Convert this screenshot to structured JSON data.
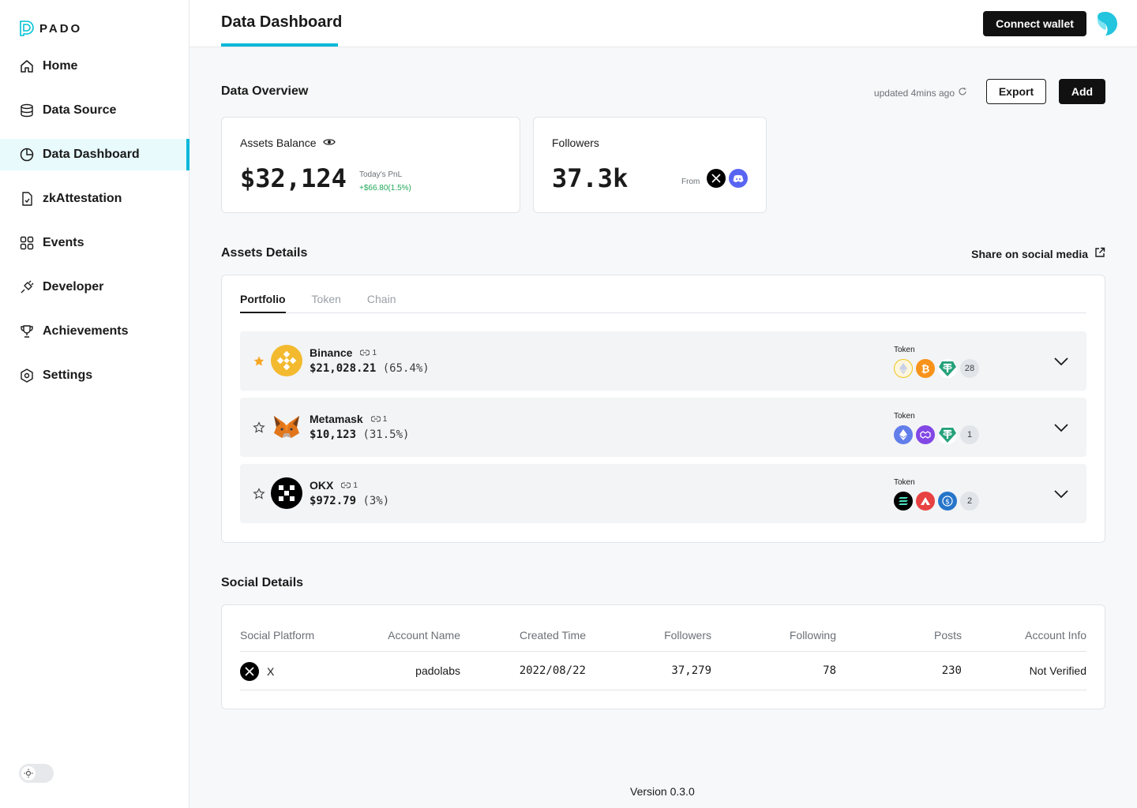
{
  "app": {
    "logo_text": "PADO"
  },
  "sidebar": {
    "items": [
      {
        "label": "Home",
        "icon": "home-icon"
      },
      {
        "label": "Data Source",
        "icon": "database-icon"
      },
      {
        "label": "Data Dashboard",
        "icon": "pie-chart-icon",
        "active": true
      },
      {
        "label": "zkAttestation",
        "icon": "document-check-icon"
      },
      {
        "label": "Events",
        "icon": "grid-icon"
      },
      {
        "label": "Developer",
        "icon": "plug-icon"
      },
      {
        "label": "Achievements",
        "icon": "trophy-icon"
      },
      {
        "label": "Settings",
        "icon": "settings-icon"
      }
    ],
    "theme_toggle": "light"
  },
  "header": {
    "title": "Data Dashboard",
    "connect_label": "Connect wallet"
  },
  "overview": {
    "title": "Data Overview",
    "updated": "updated 4mins ago",
    "export_label": "Export",
    "add_label": "Add",
    "assets": {
      "label": "Assets Balance",
      "value": "$32,124",
      "pnl_label": "Today's PnL",
      "pnl_value": "+$66.80(1.5%)"
    },
    "followers": {
      "label": "Followers",
      "value": "37.3k",
      "from_label": "From"
    }
  },
  "assets_details": {
    "title": "Assets Details",
    "share_label": "Share on social media",
    "tabs": [
      "Portfolio",
      "Token",
      "Chain"
    ],
    "token_label": "Token",
    "rows": [
      {
        "name": "Binance",
        "links": "1",
        "value": "$21,028.21",
        "pct": "(65.4%)",
        "starred": true,
        "tokens": [
          "eth",
          "btc",
          "usdt"
        ],
        "more": "28"
      },
      {
        "name": "Metamask",
        "links": "1",
        "value": "$10,123",
        "pct": "(31.5%)",
        "starred": false,
        "tokens": [
          "eth",
          "matic",
          "usdt"
        ],
        "more": "1"
      },
      {
        "name": "OKX",
        "links": "1",
        "value": "$972.79",
        "pct": "(3%)",
        "starred": false,
        "tokens": [
          "sol",
          "avax",
          "usdc"
        ],
        "more": "2"
      }
    ]
  },
  "social_details": {
    "title": "Social Details",
    "columns": [
      "Social Platform",
      "Account Name",
      "Created Time",
      "Followers",
      "Following",
      "Posts",
      "Account Info"
    ],
    "rows": [
      {
        "platform": "X",
        "account": "padolabs",
        "created": "2022/08/22",
        "followers": "37,279",
        "following": "78",
        "posts": "230",
        "info": "Not Verified"
      }
    ]
  },
  "footer": {
    "version": "Version 0.3.0"
  },
  "colors": {
    "accent": "#00b8d9",
    "positive": "#22a85a",
    "primary_button": "#111111"
  }
}
